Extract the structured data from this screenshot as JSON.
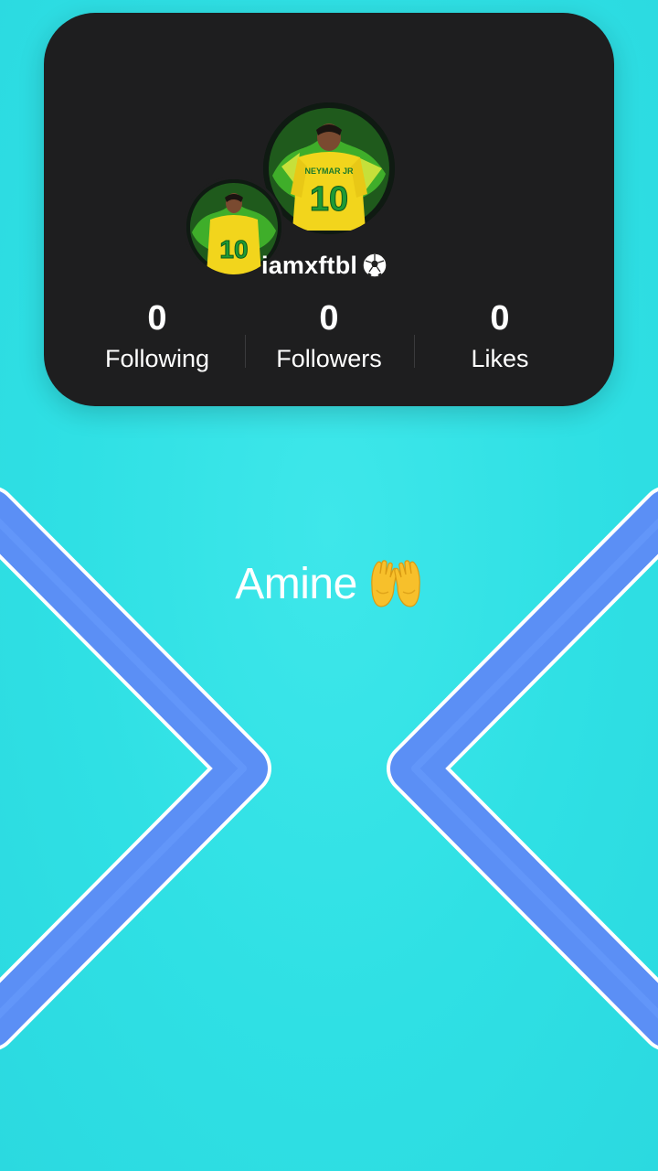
{
  "profile": {
    "username": "iamxftbl",
    "username_emoji_icon": "soccer-ball-icon",
    "avatars": [
      "player-number-10-avatar",
      "player-number-10-avatar"
    ]
  },
  "stats": {
    "following": {
      "value": "0",
      "label": "Following"
    },
    "followers": {
      "value": "0",
      "label": "Followers"
    },
    "likes": {
      "value": "0",
      "label": "Likes"
    }
  },
  "caption": {
    "text": "Amine",
    "emoji_icon": "palms-up-together-icon"
  },
  "colors": {
    "background": "#2fe0e4",
    "card": "#1e1e1f",
    "chevron_fill": "#5b8ff5",
    "chevron_outline": "#ffffff",
    "text": "#ffffff"
  }
}
